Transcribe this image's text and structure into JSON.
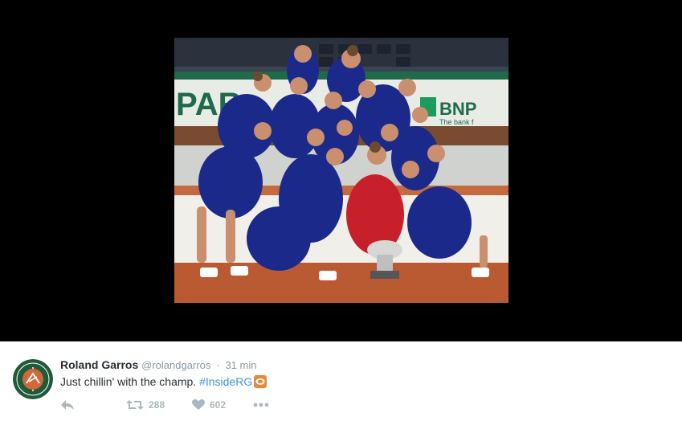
{
  "tweet": {
    "display_name": "Roland Garros",
    "handle": "@rolandgarros",
    "separator": "·",
    "timestamp": "31 min",
    "text_plain": "Just chillin' with the champ. ",
    "hashtag": "#InsideRG",
    "emoji_icon": "tennis-ball-emoji-icon",
    "avatar_logo_text": "ROLAND GARROS",
    "colors": {
      "link": "#3b94d9",
      "muted": "#8899a6",
      "action_gray": "#aab8c2",
      "avatar_green": "#1f5b3a",
      "avatar_clay": "#d3673a"
    },
    "actions": {
      "reply_icon": "reply-icon",
      "retweet_icon": "retweet-icon",
      "retweet_count": "288",
      "like_icon": "heart-icon",
      "like_count": "602",
      "more_icon": "more-dots-icon"
    }
  },
  "media": {
    "photo_banner_left": "PAR",
    "photo_banner_right": "BNP",
    "photo_banner_sub": "The bank f"
  }
}
